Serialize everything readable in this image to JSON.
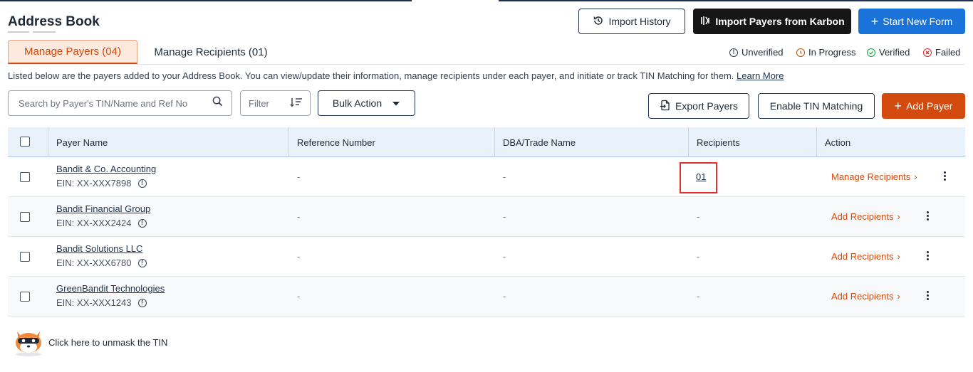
{
  "header": {
    "title": "Address Book",
    "import_history_label": "Import History",
    "import_karbon_label": "Import Payers from Karbon",
    "start_new_form_label": "Start New Form"
  },
  "tabs": [
    {
      "label": "Manage Payers (04)",
      "active": true
    },
    {
      "label": "Manage Recipients (01)",
      "active": false
    }
  ],
  "legend": {
    "unverified": "Unverified",
    "in_progress": "In Progress",
    "verified": "Verified",
    "failed": "Failed"
  },
  "description": {
    "text": "Listed below are the payers added to your Address Book. You can view/update their information, manage recipients under each payer, and initiate or track TIN Matching for them.",
    "link": "Learn More"
  },
  "toolbar": {
    "search_placeholder": "Search by Payer's TIN/Name and Ref No",
    "filter_label": "Filter",
    "bulk_action_label": "Bulk Action",
    "export_label": "Export Payers",
    "enable_tin_label": "Enable TIN Matching",
    "add_payer_label": "Add Payer"
  },
  "table": {
    "columns": [
      "Payer Name",
      "Reference Number",
      "DBA/Trade Name",
      "Recipients",
      "Action"
    ],
    "rows": [
      {
        "name": "Bandit & Co. Accounting",
        "ein": "EIN: XX-XXX7898",
        "ref": "-",
        "dba": "-",
        "recipients": "01",
        "action": "Manage Recipients"
      },
      {
        "name": "Bandit Financial Group",
        "ein": "EIN: XX-XXX2424",
        "ref": "-",
        "dba": "-",
        "recipients": "-",
        "action": "Add Recipients"
      },
      {
        "name": "Bandit Solutions LLC",
        "ein": "EIN: XX-XXX6780",
        "ref": "-",
        "dba": "-",
        "recipients": "-",
        "action": "Add Recipients"
      },
      {
        "name": "GreenBandit Technologies",
        "ein": "EIN: XX-XXX1243",
        "ref": "-",
        "dba": "-",
        "recipients": "-",
        "action": "Add Recipients"
      }
    ]
  },
  "footer": {
    "unmask_text": "Click here to unmask the TIN"
  },
  "colors": {
    "accent_orange": "#d24a0e",
    "primary_blue": "#1a73d9",
    "navy": "#1f3350",
    "verified_green": "#16a34a",
    "failed_red": "#dc2626",
    "in_progress_amber": "#b45309",
    "highlight_red": "#e0312f"
  }
}
